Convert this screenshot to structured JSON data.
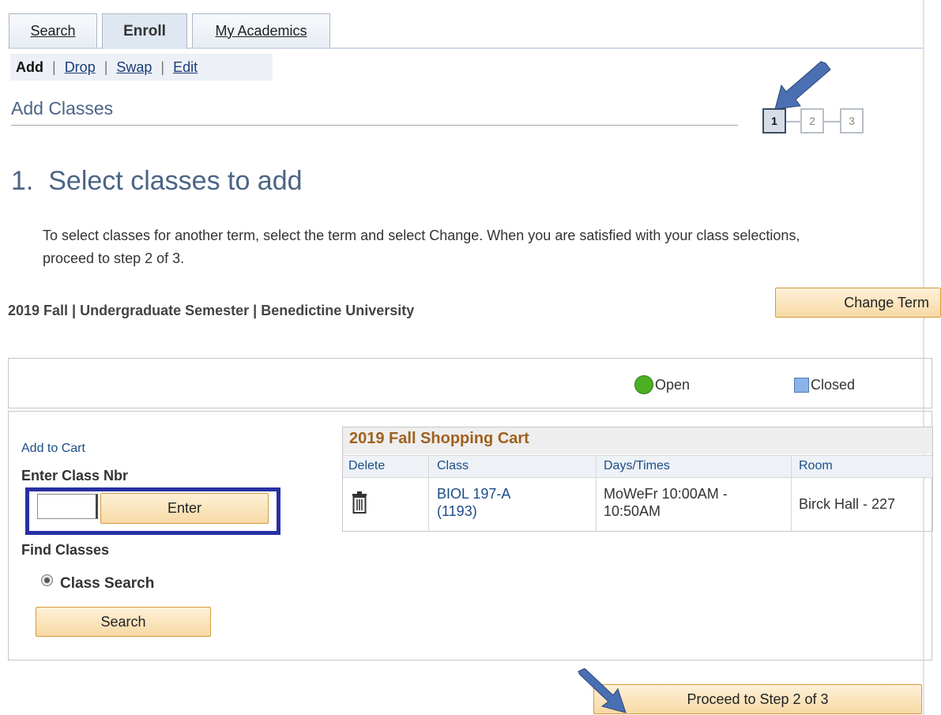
{
  "tabs": [
    {
      "label": "Search",
      "underline_index": 0
    },
    {
      "label": "Enroll"
    },
    {
      "label": "My Academics",
      "underline_index": 0
    }
  ],
  "subnav": {
    "current": "Add",
    "sep": "|",
    "links": [
      "Drop",
      "Swap",
      "Edit"
    ]
  },
  "page_title": "Add Classes",
  "steps": [
    "1",
    "2",
    "3"
  ],
  "heading": "1.  Select classes to add",
  "instructions": "To select classes for another term, select the term and select Change.  When you are satisfied with your class selections, proceed to step 2 of 3.",
  "term": "2019 Fall | Undergraduate Semester | Benedictine University",
  "change_term_button": "Change Term",
  "legend": {
    "open": "Open",
    "closed": "Closed",
    "open_color": "#4caf24",
    "closed_color": "#8ab4e8"
  },
  "add_to_cart": {
    "title": "Add to Cart",
    "enter_label": "Enter Class Nbr",
    "input_value": "",
    "enter_button": "Enter",
    "find_classes": "Find Classes",
    "class_search_option": "Class Search",
    "search_button": "Search"
  },
  "cart": {
    "title": "2019 Fall Shopping Cart",
    "columns": [
      "Delete",
      "Class",
      "Days/Times",
      "Room"
    ],
    "rows": [
      {
        "delete_icon": "trash-icon",
        "class_line1": "BIOL 197-A",
        "class_line2": "(1193)",
        "days_line1": "MoWeFr 10:00AM -",
        "days_line2": "10:50AM",
        "room": "Birck Hall - 227"
      }
    ]
  },
  "proceed_button": "Proceed to Step 2 of 3",
  "annotation_color": "#4a6fb2",
  "highlight_color": "#2730a2"
}
